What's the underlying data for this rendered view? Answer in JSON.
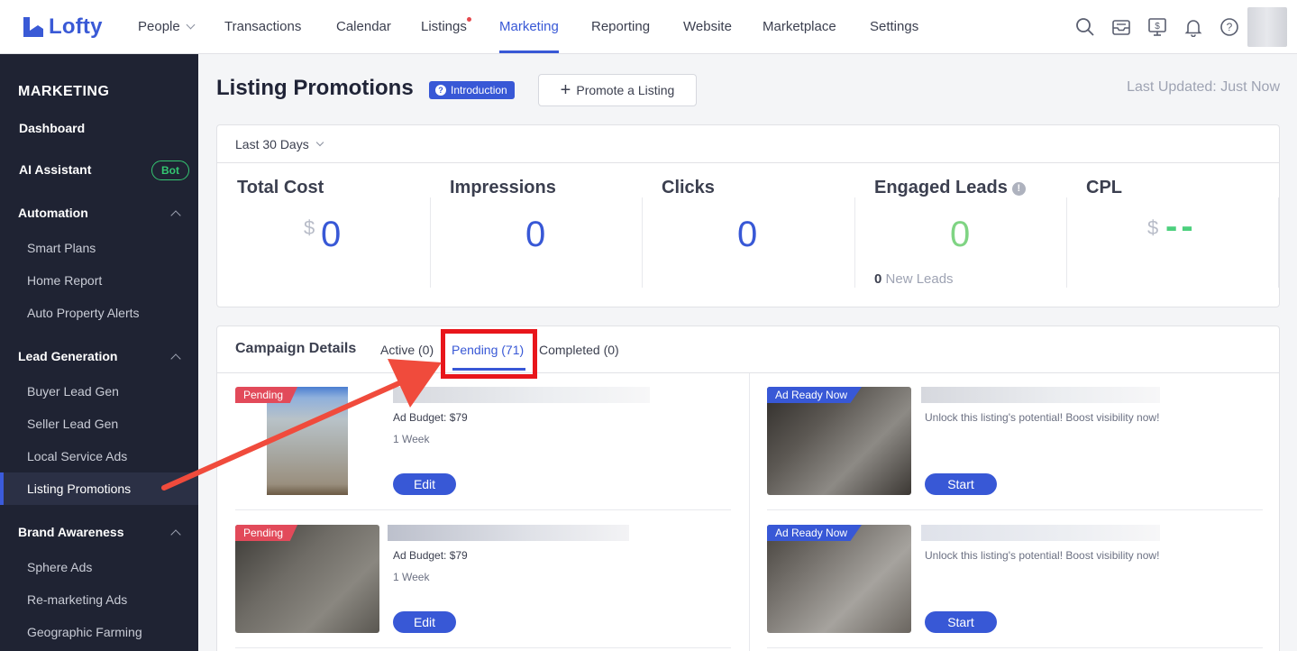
{
  "app": {
    "logo": "Lofty"
  },
  "nav": {
    "items": [
      "People",
      "Transactions",
      "Calendar",
      "Listings",
      "Marketing",
      "Reporting",
      "Website",
      "Marketplace",
      "Settings"
    ]
  },
  "sidebar": {
    "title": "MARKETING",
    "dashboard": "Dashboard",
    "ai_assistant": "AI Assistant",
    "bot_badge": "Bot",
    "automation": "Automation",
    "automation_items": [
      "Smart Plans",
      "Home Report",
      "Auto Property Alerts"
    ],
    "lead_generation": "Lead Generation",
    "lead_items": [
      "Buyer Lead Gen",
      "Seller Lead Gen",
      "Local Service Ads",
      "Listing Promotions"
    ],
    "brand_awareness": "Brand Awareness",
    "brand_items": [
      "Sphere Ads",
      "Re-marketing Ads",
      "Geographic Farming"
    ]
  },
  "header": {
    "title": "Listing Promotions",
    "intro_badge": "Introduction",
    "promote_button": "Promote a Listing",
    "last_updated": "Last Updated: Just Now"
  },
  "stats": {
    "range": "Last 30 Days",
    "total_cost": {
      "label": "Total Cost",
      "currency": "$",
      "value": "0"
    },
    "impressions": {
      "label": "Impressions",
      "value": "0"
    },
    "clicks": {
      "label": "Clicks",
      "value": "0"
    },
    "engaged_leads": {
      "label": "Engaged Leads",
      "value": "0",
      "new_count": "0",
      "new_label": "New Leads"
    },
    "cpl": {
      "label": "CPL",
      "currency": "$",
      "value": "--"
    }
  },
  "campaigns": {
    "title": "Campaign Details",
    "tabs": [
      "Active (0)",
      "Pending (71)",
      "Completed (0)"
    ],
    "active_tab": "Pending (71)",
    "left": [
      {
        "tag": "Pending",
        "budget": "Ad Budget: $79",
        "duration": "1 Week",
        "button": "Edit"
      },
      {
        "tag": "Pending",
        "budget": "Ad Budget: $79",
        "duration": "1 Week",
        "button": "Edit"
      }
    ],
    "right": [
      {
        "tag": "Ad Ready Now",
        "desc": "Unlock this listing's potential! Boost visibility now!",
        "button": "Start"
      },
      {
        "tag": "Ad Ready Now",
        "desc": "Unlock this listing's potential! Boost visibility now!",
        "button": "Start"
      }
    ]
  },
  "colors": {
    "accent": "#3858d6",
    "sidebar": "#1f2333",
    "pending": "#e24a5a",
    "green": "#4cd07d",
    "annotation": "#e8161b"
  }
}
